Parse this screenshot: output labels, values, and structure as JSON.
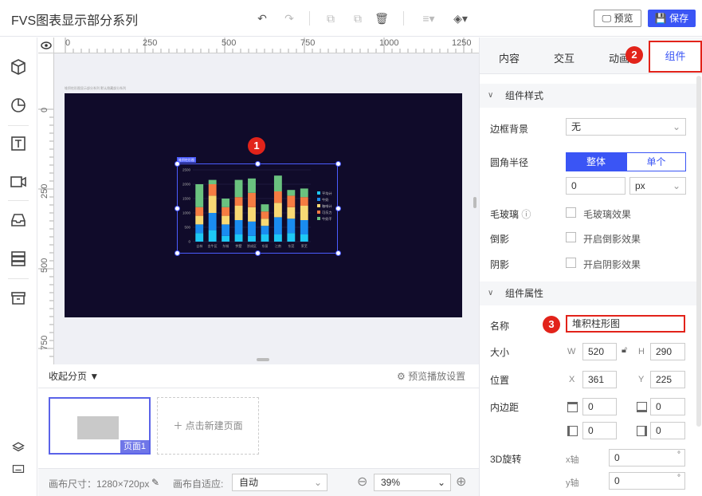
{
  "header": {
    "title": "FVS图表显示部分系列",
    "preview_label": "预览",
    "save_label": "保存"
  },
  "canvas": {
    "ruler_h": [
      "0",
      "250",
      "500",
      "750",
      "1000",
      "1250"
    ],
    "ruler_v": [
      "0",
      "250",
      "500",
      "750"
    ],
    "stage_caption": "堆积柱形图显示部分系列   默认隐藏部分系列",
    "chart_tag": "堆积柱形图",
    "badge1": "1"
  },
  "chart_data": {
    "type": "bar",
    "stacked": true,
    "categories": [
      "吉林",
      "金牛区",
      "东城",
      "拱墅",
      "崇成区",
      "东丽",
      "江南",
      "东莞",
      "莱芜"
    ],
    "ylim": [
      0,
      2500
    ],
    "yticks": [
      "0",
      "500",
      "1000",
      "1500",
      "2000",
      "2500"
    ],
    "series": [
      {
        "name": "平均计",
        "color": "#1ec8f5",
        "values": [
          300,
          400,
          200,
          250,
          200,
          250,
          250,
          300,
          250
        ]
      },
      {
        "name": "牛奶",
        "color": "#1a8cf0",
        "values": [
          300,
          600,
          400,
          500,
          500,
          300,
          600,
          500,
          500
        ]
      },
      {
        "name": "咖啡计",
        "color": "#f8d974",
        "values": [
          300,
          600,
          300,
          500,
          500,
          250,
          500,
          400,
          500
        ]
      },
      {
        "name": "可乐力",
        "color": "#f57c42",
        "values": [
          300,
          400,
          300,
          300,
          500,
          250,
          400,
          400,
          300
        ]
      },
      {
        "name": "牛奶干",
        "color": "#6ac27f",
        "values": [
          800,
          150,
          300,
          600,
          500,
          250,
          550,
          200,
          300
        ]
      }
    ]
  },
  "pages": {
    "collapse_label": "收起分页",
    "preview_settings": "预览播放设置",
    "page1_label": "页面1",
    "new_page_label": "点击新建页面"
  },
  "bottom": {
    "canvas_size": "画布尺寸：1280×720px",
    "auto_fit_label": "画布自适应:",
    "auto_fit_value": "自动",
    "zoom": "39%"
  },
  "panel": {
    "tabs": [
      "内容",
      "交互",
      "动画",
      "组件"
    ],
    "badge2": "2",
    "badge3": "3",
    "style_section": "组件样式",
    "border_bg_label": "边框背景",
    "border_bg_value": "无",
    "radius_label": "圆角半径",
    "radius_whole": "整体",
    "radius_single": "单个",
    "radius_value": "0",
    "radius_unit": "px",
    "glass_label": "毛玻璃",
    "glass_check": "毛玻璃效果",
    "reflect_label": "倒影",
    "reflect_check": "开启倒影效果",
    "shadow_label": "阴影",
    "shadow_check": "开启阴影效果",
    "attr_section": "组件属性",
    "name_label": "名称",
    "name_value": "堆积柱形图",
    "size_label": "大小",
    "w_label": "W",
    "w_value": "520",
    "h_label": "H",
    "h_value": "290",
    "pos_label": "位置",
    "x_label": "X",
    "x_value": "361",
    "y_label": "Y",
    "y_value": "225",
    "padding_label": "内边距",
    "pad_top": "0",
    "pad_bottom": "0",
    "pad_left": "0",
    "pad_right": "0",
    "rot_label": "3D旋转",
    "x_axis": "x轴",
    "x_axis_value": "0",
    "y_axis": "y轴",
    "y_axis_value": "0"
  }
}
